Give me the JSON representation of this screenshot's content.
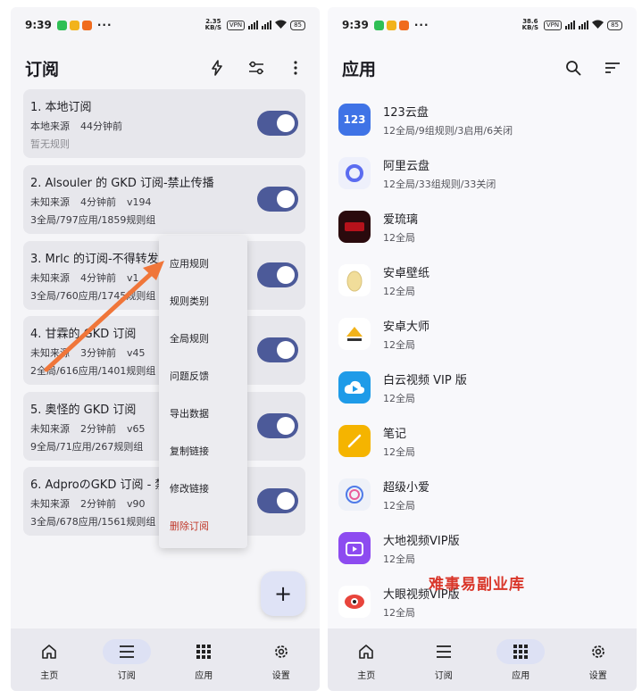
{
  "left": {
    "status": {
      "time": "9:39",
      "speed": "2.35 KB/S",
      "vpn": "VPN",
      "battery": "85"
    },
    "title": "订阅",
    "subscriptions": [
      {
        "title": "1. 本地订阅",
        "source": "本地来源",
        "time": "44分钟前",
        "version": "",
        "stats": "暂无规则",
        "enabled": true
      },
      {
        "title": "2. Alsouler 的 GKD 订阅-禁止传播",
        "source": "未知来源",
        "time": "4分钟前",
        "version": "v194",
        "stats": "3全局/797应用/1859规则组",
        "enabled": true
      },
      {
        "title": "3. Mrlc 的订阅-不得转发",
        "source": "未知来源",
        "time": "4分钟前",
        "version": "v1",
        "stats": "3全局/760应用/1745规则组",
        "enabled": true
      },
      {
        "title": "4. 甘霖的 GKD 订阅",
        "source": "未知来源",
        "time": "3分钟前",
        "version": "v45",
        "stats": "2全局/616应用/1401规则组",
        "enabled": true
      },
      {
        "title": "5. 奥怪的 GKD 订阅",
        "source": "未知来源",
        "time": "2分钟前",
        "version": "v65",
        "stats": "9全局/71应用/267规则组",
        "enabled": true
      },
      {
        "title": "6. AdproのGKD 订阅 - 禁止传播",
        "source": "未知来源",
        "time": "2分钟前",
        "version": "v90",
        "stats": "3全局/678应用/1561规则组",
        "enabled": true
      }
    ],
    "menu": [
      "应用规则",
      "规则类别",
      "全局规则",
      "问题反馈",
      "导出数据",
      "复制链接",
      "修改链接",
      "删除订阅"
    ],
    "fab": "+",
    "nav": [
      {
        "label": "主页",
        "icon": "home-icon",
        "active": false
      },
      {
        "label": "订阅",
        "icon": "list-icon",
        "active": true
      },
      {
        "label": "应用",
        "icon": "grid-icon",
        "active": false
      },
      {
        "label": "设置",
        "icon": "settings-icon",
        "active": false
      }
    ]
  },
  "right": {
    "status": {
      "time": "9:39",
      "speed": "38.6 KB/S",
      "vpn": "VPN",
      "battery": "85"
    },
    "title": "应用",
    "apps": [
      {
        "name": "123云盘",
        "sub": "12全局/9组规则/3启用/6关闭",
        "icon": "123-cloud-icon",
        "color": "#3f73e6",
        "glyph": "123"
      },
      {
        "name": "阿里云盘",
        "sub": "12全局/33组规则/33关闭",
        "icon": "aliyun-drive-icon",
        "color": "#5b6cf0",
        "glyph": ""
      },
      {
        "name": "爱琉璃",
        "sub": "12全局",
        "icon": "ailiuli-icon",
        "color": "#b5121b",
        "glyph": ""
      },
      {
        "name": "安卓壁纸",
        "sub": "12全局",
        "icon": "egg-wallpaper-icon",
        "color": "#ffffff",
        "glyph": ""
      },
      {
        "name": "安卓大师",
        "sub": "12全局",
        "icon": "android-master-icon",
        "color": "#ffffff",
        "glyph": ""
      },
      {
        "name": "白云视频 VIP 版",
        "sub": "12全局",
        "icon": "cloud-video-icon",
        "color": "#1e9be8",
        "glyph": ""
      },
      {
        "name": "笔记",
        "sub": "12全局",
        "icon": "notes-icon",
        "color": "#f5b400",
        "glyph": ""
      },
      {
        "name": "超级小爱",
        "sub": "12全局",
        "icon": "xiaoai-icon",
        "color": "#eef1f8",
        "glyph": ""
      },
      {
        "name": "大地视频VIP版",
        "sub": "12全局",
        "icon": "dadi-video-icon",
        "color": "#8d4bf0",
        "glyph": ""
      },
      {
        "name": "大眼视频VIP版",
        "sub": "12全局",
        "icon": "dayan-video-icon",
        "color": "#ffffff",
        "glyph": ""
      }
    ],
    "nav": [
      {
        "label": "主页",
        "icon": "home-icon",
        "active": false
      },
      {
        "label": "订阅",
        "icon": "list-icon",
        "active": false
      },
      {
        "label": "应用",
        "icon": "grid-icon",
        "active": true
      },
      {
        "label": "设置",
        "icon": "settings-icon",
        "active": false
      }
    ]
  },
  "watermark": "难事易副业库"
}
